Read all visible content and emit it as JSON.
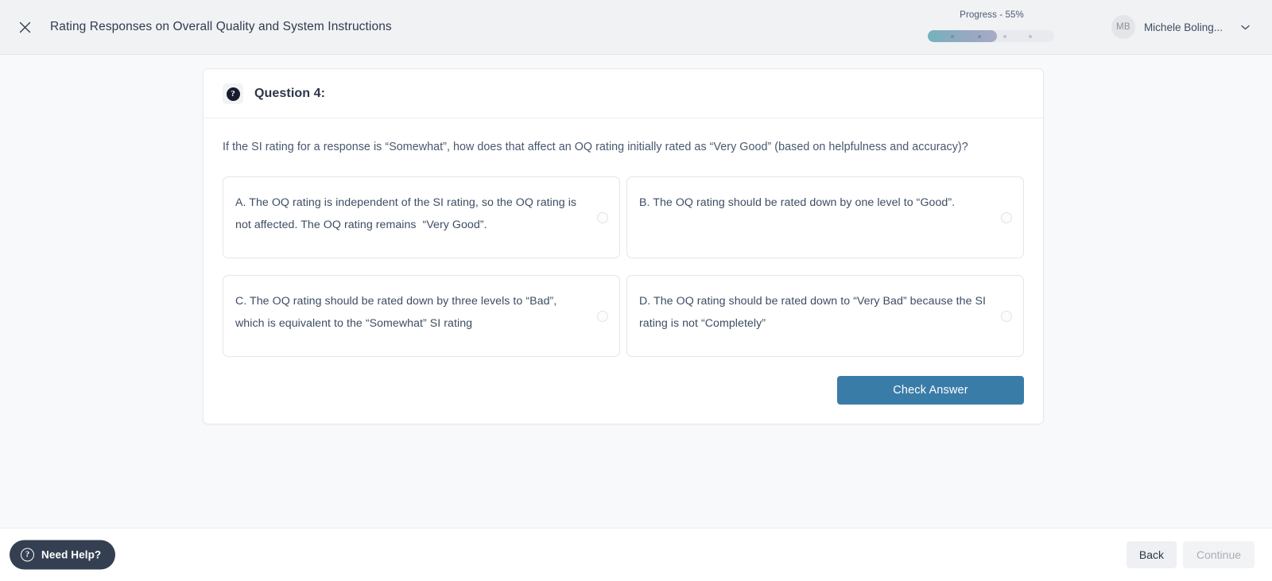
{
  "topbar": {
    "close_icon": "close-icon",
    "title": "Rating Responses on Overall Quality and System Instructions",
    "progress": {
      "label": "Progress - 55%",
      "percent": 55,
      "steps": 4,
      "completed_steps": 2
    },
    "user": {
      "initials": "MB",
      "name": "Michele Boling...",
      "caret_icon": "chevron-down-icon"
    }
  },
  "question_card": {
    "icon": "question-mark-icon",
    "icon_glyph": "?",
    "title": "Question 4:",
    "prompt": "If the SI rating for a response is “Somewhat”, how does that affect an OQ rating initially rated as “Very Good” (based on helpfulness and accuracy)?",
    "options": [
      {
        "id": "A",
        "text": "A. The OQ rating is independent of the SI rating, so the OQ rating is not affected. The OQ rating remains  “Very Good”.",
        "selected": false
      },
      {
        "id": "B",
        "text": "B. The OQ rating should be rated down by one level to “Good”.",
        "selected": false
      },
      {
        "id": "C",
        "text": "C. The OQ rating should be rated down by three levels to “Bad”, which is equivalent to the “Somewhat” SI rating",
        "selected": false
      },
      {
        "id": "D",
        "text": "D. The OQ rating should be rated down to “Very Bad” because the SI rating is not “Completely”",
        "selected": false
      }
    ],
    "check_answer_label": "Check Answer"
  },
  "footer": {
    "need_help": {
      "icon": "question-circle-icon",
      "icon_glyph": "?",
      "label": "Need Help?"
    },
    "back_label": "Back",
    "continue_label": "Continue",
    "continue_disabled": true
  },
  "colors": {
    "page_background": "#f8f9fa",
    "topbar_background": "#f1f2f4",
    "card_background": "#ffffff",
    "primary_button": "#3a7ca8",
    "help_pill": "#353f52",
    "progress_fill_start": "#74b2bd",
    "progress_fill_end": "#a8abc6",
    "text_primary": "#3d4d63",
    "text_heading": "#2b3649"
  }
}
